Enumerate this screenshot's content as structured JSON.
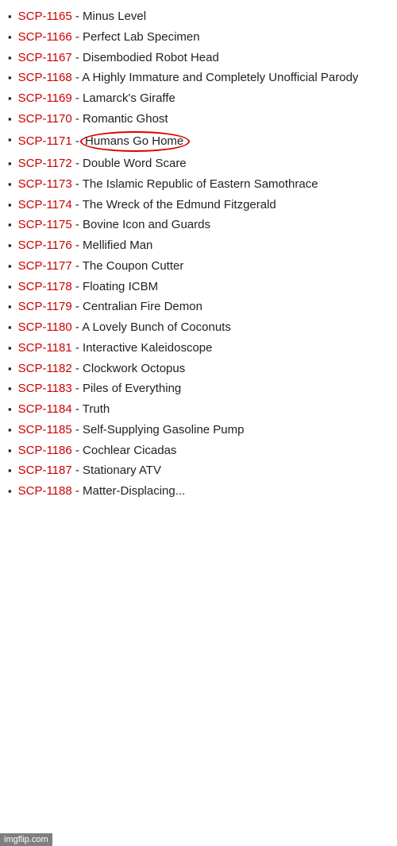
{
  "items": [
    {
      "id": "SCP-1165",
      "desc": "Minus Level",
      "circled": false
    },
    {
      "id": "SCP-1166",
      "desc": "Perfect Lab Specimen",
      "circled": false
    },
    {
      "id": "SCP-1167",
      "desc": "Disembodied Robot Head",
      "circled": false
    },
    {
      "id": "SCP-1168",
      "desc": "A Highly Immature and Completely Unofficial Parody",
      "circled": false
    },
    {
      "id": "SCP-1169",
      "desc": "Lamarck's Giraffe",
      "circled": false
    },
    {
      "id": "SCP-1170",
      "desc": "Romantic Ghost",
      "circled": false
    },
    {
      "id": "SCP-1171",
      "desc": "Humans Go Home",
      "circled": true
    },
    {
      "id": "SCP-1172",
      "desc": "Double Word Scare",
      "circled": false
    },
    {
      "id": "SCP-1173",
      "desc": "The Islamic Republic of Eastern Samothrace",
      "circled": false
    },
    {
      "id": "SCP-1174",
      "desc": "The Wreck of the Edmund Fitzgerald",
      "circled": false
    },
    {
      "id": "SCP-1175",
      "desc": "Bovine Icon and Guards",
      "circled": false
    },
    {
      "id": "SCP-1176",
      "desc": "Mellified Man",
      "circled": false
    },
    {
      "id": "SCP-1177",
      "desc": "The Coupon Cutter",
      "circled": false
    },
    {
      "id": "SCP-1178",
      "desc": "Floating ICBM",
      "circled": false
    },
    {
      "id": "SCP-1179",
      "desc": "Centralian Fire Demon",
      "circled": false
    },
    {
      "id": "SCP-1180",
      "desc": "A Lovely Bunch of Coconuts",
      "circled": false
    },
    {
      "id": "SCP-1181",
      "desc": "Interactive Kaleidoscope",
      "circled": false
    },
    {
      "id": "SCP-1182",
      "desc": "Clockwork Octopus",
      "circled": false
    },
    {
      "id": "SCP-1183",
      "desc": "Piles of Everything",
      "circled": false
    },
    {
      "id": "SCP-1184",
      "desc": "Truth",
      "circled": false
    },
    {
      "id": "SCP-1185",
      "desc": "Self-Supplying Gasoline Pump",
      "circled": false
    },
    {
      "id": "SCP-1186",
      "desc": "Cochlear Cicadas",
      "circled": false
    },
    {
      "id": "SCP-1187",
      "desc": "Stationary ATV",
      "circled": false
    },
    {
      "id": "SCP-1188",
      "desc": "Matter-Displacing",
      "circled": false,
      "truncated": true
    }
  ],
  "imgflip_label": "imgflip.com"
}
